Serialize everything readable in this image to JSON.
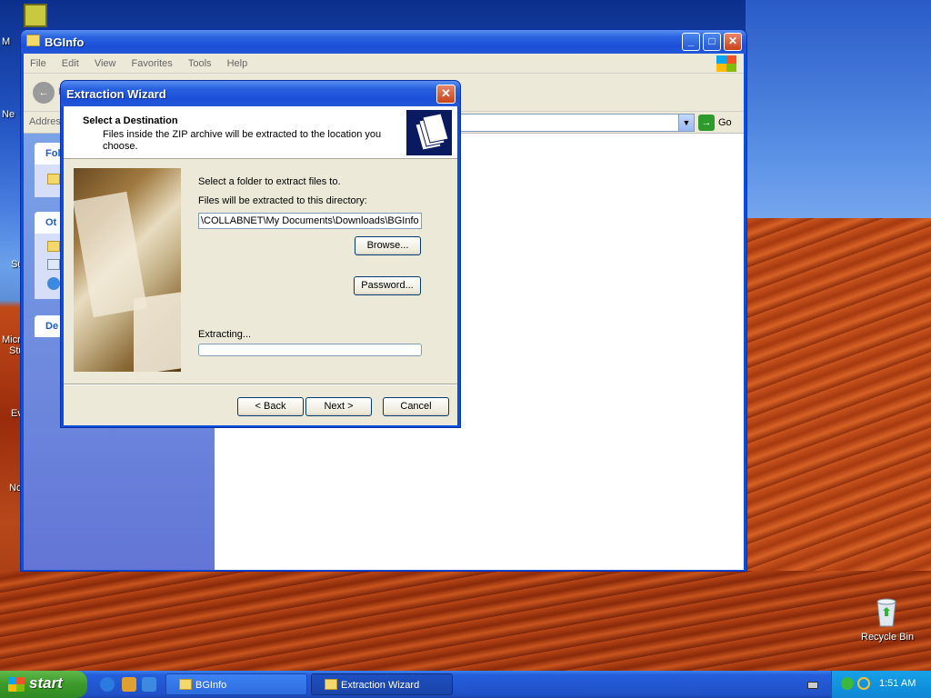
{
  "desktop": {
    "recycle_bin_label": "Recycle Bin",
    "left_labels": [
      "M",
      "Ne",
      "Su",
      "Micro",
      "Stu",
      "Ev",
      "No"
    ]
  },
  "explorer": {
    "title": "BGInfo",
    "menu": [
      "File",
      "Edit",
      "View",
      "Favorites",
      "Tools",
      "Help"
    ],
    "back_label": "B",
    "address_label": "Address",
    "go_label": "Go",
    "left_tasks": [
      "Fol",
      "Ot",
      "De"
    ]
  },
  "wizard": {
    "title": "Extraction Wizard",
    "header_title": "Select a Destination",
    "header_desc": "Files inside the ZIP archive will be extracted to the location you choose.",
    "select_folder_text": "Select a folder to extract files to.",
    "directory_label": "Files will be extracted to this directory:",
    "directory_value": "\\COLLABNET\\My Documents\\Downloads\\BGInfo",
    "browse_label": "Browse...",
    "password_label": "Password...",
    "extracting_label": "Extracting...",
    "progress_fraction": 0,
    "back_button": "< Back",
    "next_button": "Next >",
    "cancel_button": "Cancel"
  },
  "taskbar": {
    "start_label": "start",
    "tasks": [
      "BGInfo",
      "Extraction Wizard"
    ],
    "clock": "1:51 AM"
  }
}
